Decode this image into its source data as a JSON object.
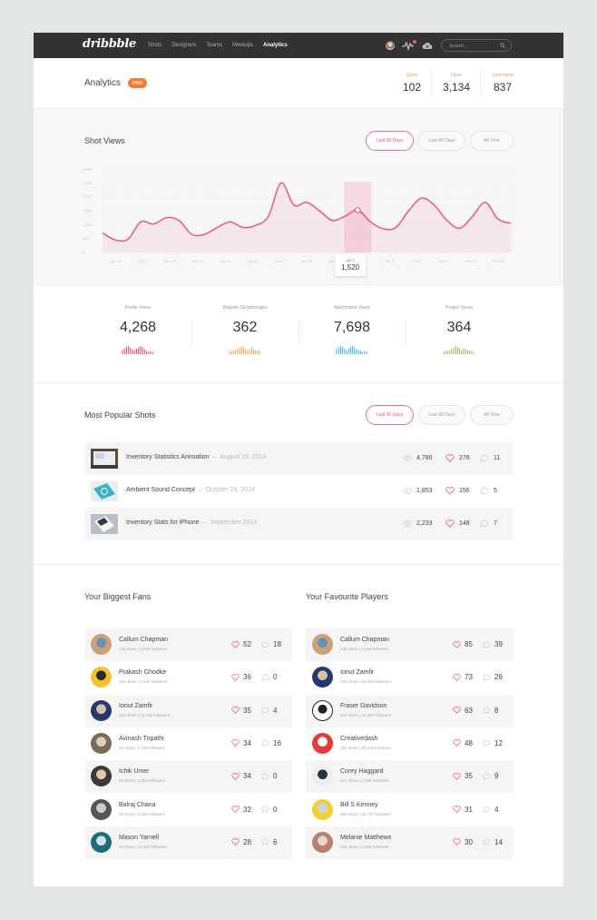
{
  "nav": {
    "logo": "dribbble",
    "links": [
      {
        "label": "Shots",
        "active": false
      },
      {
        "label": "Designers",
        "active": false
      },
      {
        "label": "Teams",
        "active": false
      },
      {
        "label": "Meetups",
        "active": false
      },
      {
        "label": "Analytics",
        "active": true
      }
    ],
    "icons": [
      "user-avatar",
      "activity-icon",
      "cloud-upload-icon"
    ],
    "search_placeholder": "Search..."
  },
  "header": {
    "title": "Analytics",
    "badge": "PRO",
    "stats": [
      {
        "label": "Shots",
        "value": "102"
      },
      {
        "label": "Likes",
        "value": "3,134"
      },
      {
        "label": "Comments",
        "value": "837"
      }
    ]
  },
  "shot_views": {
    "title": "Shot Views",
    "filters": [
      {
        "label": "Last 30 Days",
        "active": true
      },
      {
        "label": "Last 90 Days",
        "active": false
      },
      {
        "label": "All Time",
        "active": false
      }
    ],
    "tooltip": {
      "date": "Jan 1",
      "value": "1,520"
    }
  },
  "chart_data": {
    "type": "area",
    "title": "Shot Views",
    "xlabel": "",
    "ylabel": "",
    "y_tick_labels": [
      "0",
      "500",
      "1,000",
      "1,500",
      "2,000",
      "2,500",
      "3,000"
    ],
    "ylim": [
      0,
      3000
    ],
    "x_tick_labels": [
      "Jan 15",
      "Jan 17",
      "Jan 19",
      "Jan 21",
      "Jan 23",
      "Jan 25",
      "Jan 27",
      "Jan 29",
      "Jan 31",
      "Feb 2",
      "Feb 4",
      "Feb 6",
      "Feb 8",
      "Feb 10",
      "Feb 12"
    ],
    "grid": true,
    "color": "#ea4c89",
    "series": [
      {
        "name": "Shot Views",
        "points": [
          700,
          450,
          480,
          1100,
          1020,
          1250,
          1150,
          650,
          650,
          900,
          1100,
          900,
          970,
          1300,
          2500,
          1700,
          1800,
          1500,
          1150,
          1300,
          1520,
          1100,
          850,
          900,
          1500,
          1950,
          1700,
          1150,
          870,
          1300,
          1800,
          1200,
          1050
        ]
      }
    ],
    "highlight": {
      "label": "Jan 1",
      "value": 1520
    }
  },
  "stats": [
    {
      "label": "Profile Views",
      "value": "4,268",
      "color": "#ea4c89",
      "spark": [
        0.5,
        0.7,
        0.9,
        1,
        0.8,
        0.6,
        0.5,
        0.7,
        0.8,
        1,
        0.9,
        0.6,
        0.4,
        0.3,
        0.4,
        0.3
      ]
    },
    {
      "label": "Website Clickthroughs",
      "value": "362",
      "color": "#f7a55e",
      "spark": [
        0.3,
        0.4,
        0.4,
        0.5,
        0.7,
        0.8,
        1,
        0.8,
        0.6,
        0.4,
        0.6,
        0.9,
        0.6,
        0.5,
        0.4,
        0.4
      ]
    },
    {
      "label": "Attachment Views",
      "value": "7,698",
      "color": "#3cc2e0",
      "spark": [
        0.6,
        0.8,
        1,
        0.9,
        0.7,
        0.5,
        0.7,
        0.9,
        1,
        0.8,
        0.6,
        0.5,
        0.4,
        0.3,
        0.4,
        0.3
      ]
    },
    {
      "label": "Project Views",
      "value": "364",
      "color": "#9cc46b",
      "spark": [
        0.3,
        0.4,
        0.4,
        0.5,
        0.6,
        0.8,
        1,
        0.9,
        0.7,
        0.5,
        0.7,
        0.6,
        0.5,
        0.4,
        0.4,
        0.3
      ]
    }
  ],
  "popular": {
    "title": "Most Popular Shots",
    "filters": [
      {
        "label": "Last 30 Days",
        "active": true
      },
      {
        "label": "Last 90 Days",
        "active": false
      },
      {
        "label": "All Time",
        "active": false
      }
    ],
    "shots": [
      {
        "title": "Inventory Statistics Animation",
        "date": "August 19, 2014",
        "views": "4,780",
        "likes": "276",
        "comments": "11"
      },
      {
        "title": "Ambient Sound Concept",
        "date": "October 24, 2014",
        "views": "1,853",
        "likes": "156",
        "comments": "5"
      },
      {
        "title": "Inventory Stats for iPhone",
        "date": "September 2014",
        "views": "2,233",
        "likes": "148",
        "comments": "7"
      }
    ]
  },
  "fans": {
    "title": "Your Biggest Fans",
    "items": [
      {
        "name": "Callum Chapman",
        "meta": "146 shots  |  3,268 followers",
        "likes": "52",
        "comments": "18"
      },
      {
        "name": "Prakash Ghodke",
        "meta": "104 shots  |  4,349 followers",
        "likes": "36",
        "comments": "0"
      },
      {
        "name": "Ionut Zamfir",
        "meta": "332 shots  |  13,615 followers",
        "likes": "35",
        "comments": "4"
      },
      {
        "name": "Avinash Tripathi",
        "meta": "64 shots  |  1,738 followers",
        "likes": "34",
        "comments": "16"
      },
      {
        "name": "Ichik Umer",
        "meta": "89 shots  |  1,853 followers",
        "likes": "34",
        "comments": "0"
      },
      {
        "name": "Balraj Chana",
        "meta": "56 shots  |  2,399 followers",
        "likes": "32",
        "comments": "0"
      },
      {
        "name": "Mason Yarnell",
        "meta": "53 shots  |  11,496 followers",
        "likes": "28",
        "comments": "6"
      }
    ]
  },
  "players": {
    "title": "Your Favourite Players",
    "items": [
      {
        "name": "Callum Chapman",
        "meta": "146 shots  |  3,268 followers",
        "likes": "85",
        "comments": "39"
      },
      {
        "name": "Ionut Zamfir",
        "meta": "332 shots  |  13,615 followers",
        "likes": "73",
        "comments": "26"
      },
      {
        "name": "Fraser Davidson",
        "meta": "910 shots  |  19,262 followers",
        "likes": "63",
        "comments": "8"
      },
      {
        "name": "Creativedash",
        "meta": "392 shots  |  39,186 followers",
        "likes": "48",
        "comments": "12"
      },
      {
        "name": "Corey Haggard",
        "meta": "247 shots  |  5,766 followers",
        "likes": "35",
        "comments": "9"
      },
      {
        "name": "Bill S Kenney",
        "meta": "489 shots  |  35,737 followers",
        "likes": "31",
        "comments": "4"
      },
      {
        "name": "Melanie Matthews",
        "meta": "254 shots  |  3,959 followers",
        "likes": "30",
        "comments": "14"
      }
    ]
  }
}
